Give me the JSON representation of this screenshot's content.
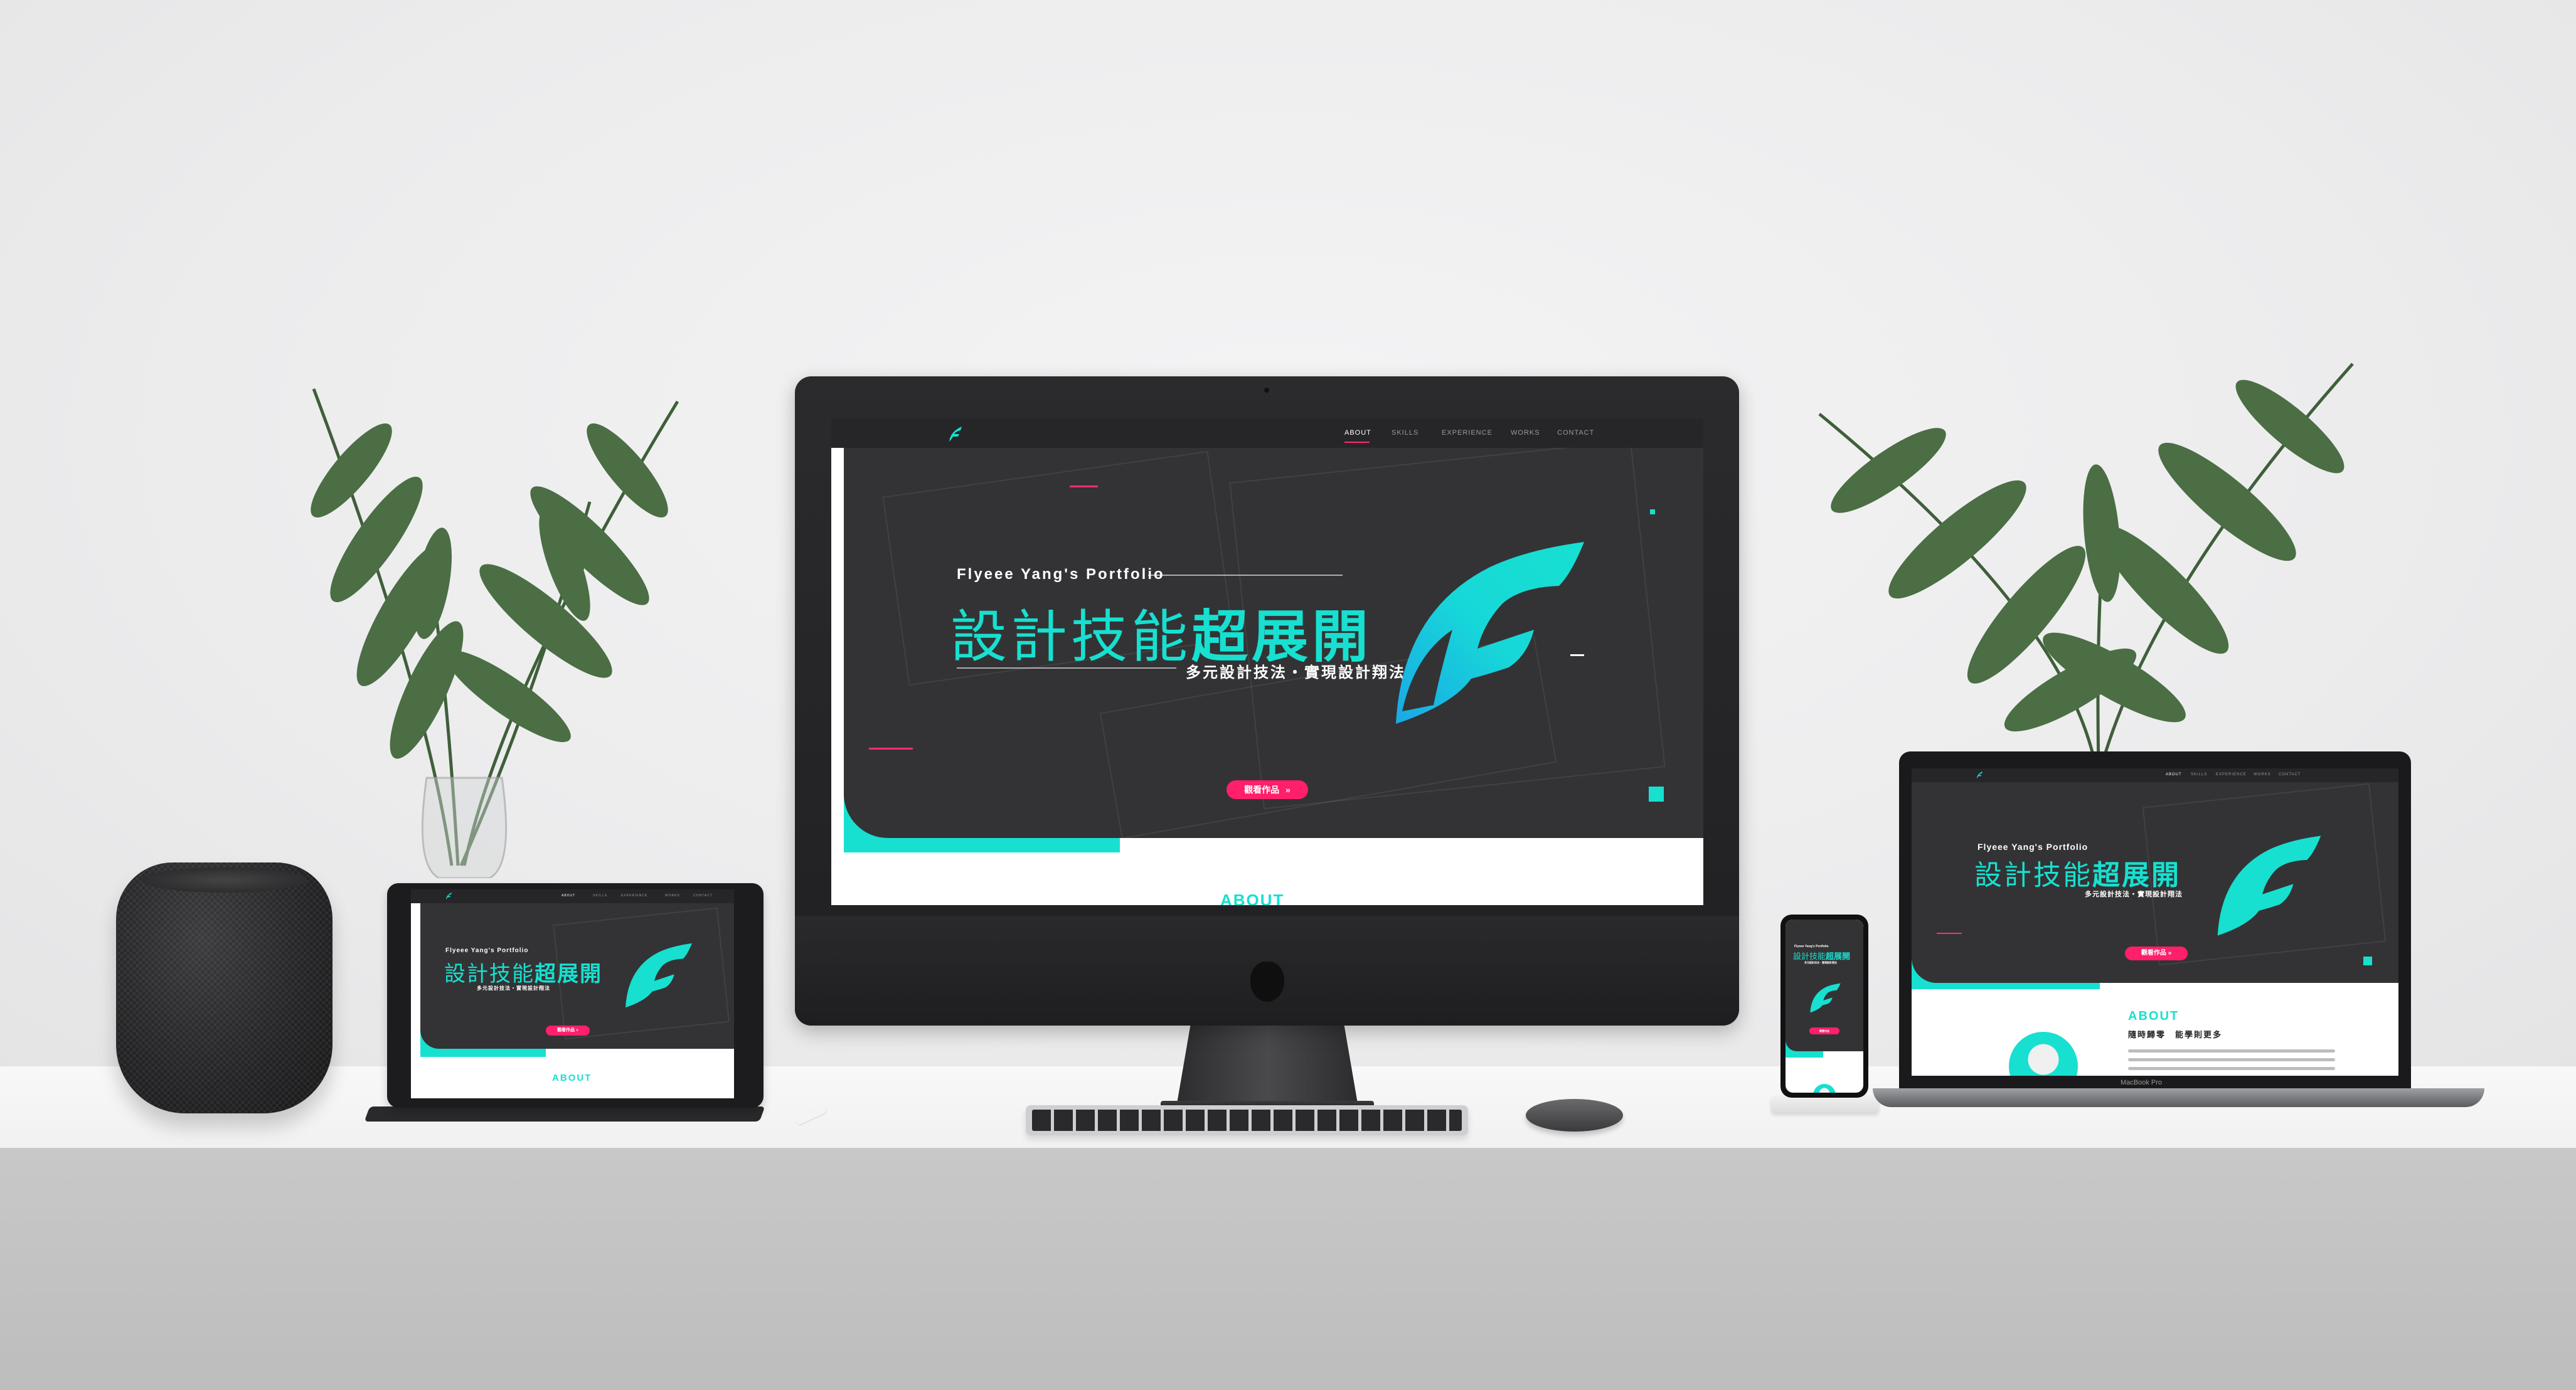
{
  "colors": {
    "accent": "#17e0d0",
    "cta": "#ff1f6b",
    "dark": "#333335",
    "nav_bg": "#262628"
  },
  "site": {
    "nav": [
      "ABOUT",
      "SKILLS",
      "EXPERIENCE",
      "WORKS",
      "CONTACT"
    ],
    "active_nav": "ABOUT",
    "hero_subtitle": "Flyeee Yang's Portfolio",
    "hero_title_light": "設計技能",
    "hero_title_bold": "超展開",
    "hero_tagline": "多元設計技法・實現設計翔法",
    "cta_label": "觀看作品",
    "cta_icon": "chevron-double-down-icon",
    "about_heading": "ABOUT",
    "about_subtitle": "隨時歸零　能學則更多",
    "logo_icon": "flyeee-f-logo"
  },
  "devices": {
    "macbook_label": "MacBook Pro"
  },
  "icons": {
    "apple": "apple-logo-icon"
  }
}
